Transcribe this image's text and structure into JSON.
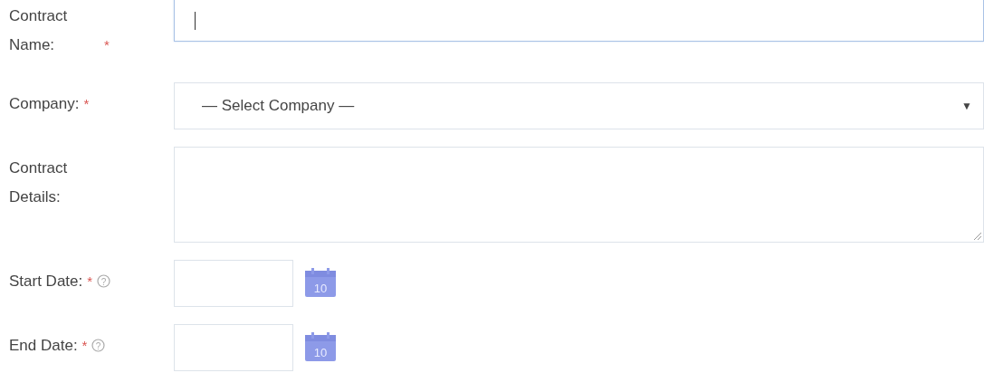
{
  "form": {
    "fields": [
      {
        "kind": "text",
        "label": "Contract Name:",
        "required": true,
        "help": false,
        "focused": true
      },
      {
        "kind": "select",
        "label": "Company:",
        "required": true,
        "help": false,
        "focused": false,
        "value": "— Select Company —",
        "caret": "▼"
      },
      {
        "kind": "textarea",
        "label": "Contract Details:",
        "required": false,
        "help": false,
        "focused": false
      },
      {
        "kind": "date",
        "label": "Start Date:",
        "required": true,
        "help": true,
        "focused": false,
        "calendar_label": "10"
      },
      {
        "kind": "date",
        "label": "End Date:",
        "required": true,
        "help": true,
        "focused": false,
        "calendar_label": "10"
      }
    ],
    "required_mark": "*",
    "help_mark": "?"
  }
}
